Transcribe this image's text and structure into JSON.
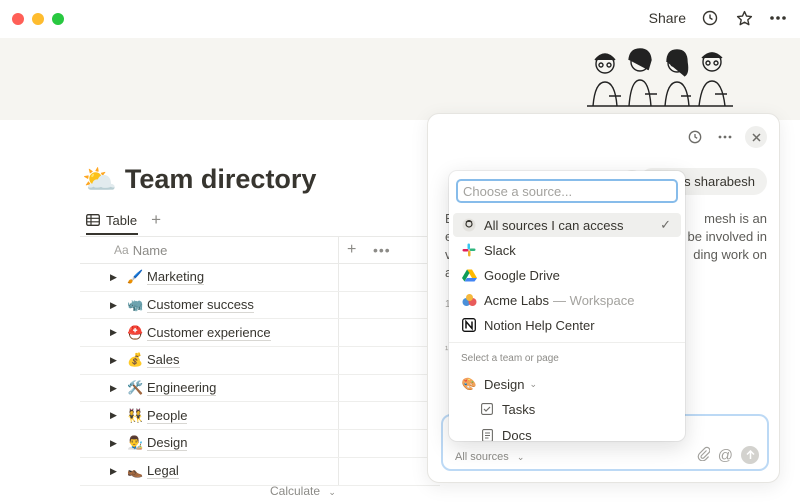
{
  "topbar": {
    "share_label": "Share",
    "icons": [
      "history-icon",
      "star-icon",
      "more-icon"
    ]
  },
  "page": {
    "title_emoji": "⛅",
    "title": "Team directory",
    "view_tab": "Table",
    "add_view": "+",
    "calculate": "Calculate"
  },
  "table": {
    "header_name_prefix": "Aa",
    "header_name": "Name",
    "header_add": "+",
    "header_more": "•••",
    "rows": [
      {
        "emoji": "🖌️",
        "label": "Marketing"
      },
      {
        "emoji": "🦏",
        "label": "Customer success"
      },
      {
        "emoji": "⛑️",
        "label": "Customer experience"
      },
      {
        "emoji": "💰",
        "label": "Sales"
      },
      {
        "emoji": "🛠️",
        "label": "Engineering"
      },
      {
        "emoji": "👯",
        "label": "People"
      },
      {
        "emoji": "👨‍🎨",
        "label": "Design"
      },
      {
        "emoji": "👞",
        "label": "Legal"
      }
    ]
  },
  "ai_panel": {
    "user_message": "Who is sharabesh",
    "answer_fragment_lines": [
      "B",
      "e",
      "v",
      "a"
    ],
    "answer_right_lines": [
      "mesh is an",
      "be involved in",
      "ding work on",
      ""
    ],
    "side_glyph_1": "1",
    "side_glyph_2": "¹",
    "all_sources_label": "All sources"
  },
  "dropdown": {
    "search_placeholder": "Choose a source...",
    "items": [
      {
        "icon": "workspace-avatar-icon",
        "label": "All sources I can access",
        "sub": "",
        "selected": true
      },
      {
        "icon": "slack-icon",
        "label": "Slack",
        "sub": "",
        "selected": false
      },
      {
        "icon": "google-drive-icon",
        "label": "Google Drive",
        "sub": "",
        "selected": false
      },
      {
        "icon": "acme-labs-icon",
        "label": "Acme Labs",
        "sub": "— Workspace",
        "selected": false
      },
      {
        "icon": "notion-icon",
        "label": "Notion Help Center",
        "sub": "",
        "selected": false
      }
    ],
    "section_label": "Select a team or page",
    "tree": [
      {
        "icon": "palette-icon",
        "label": "Design"
      },
      {
        "icon": "checkbox-icon",
        "label": "Tasks"
      },
      {
        "icon": "doc-icon",
        "label": "Docs"
      }
    ]
  },
  "colors": {
    "accent": "#87bcea",
    "text": "#37352f",
    "muted": "#8c8b87",
    "cover": "#f6f5f1"
  }
}
